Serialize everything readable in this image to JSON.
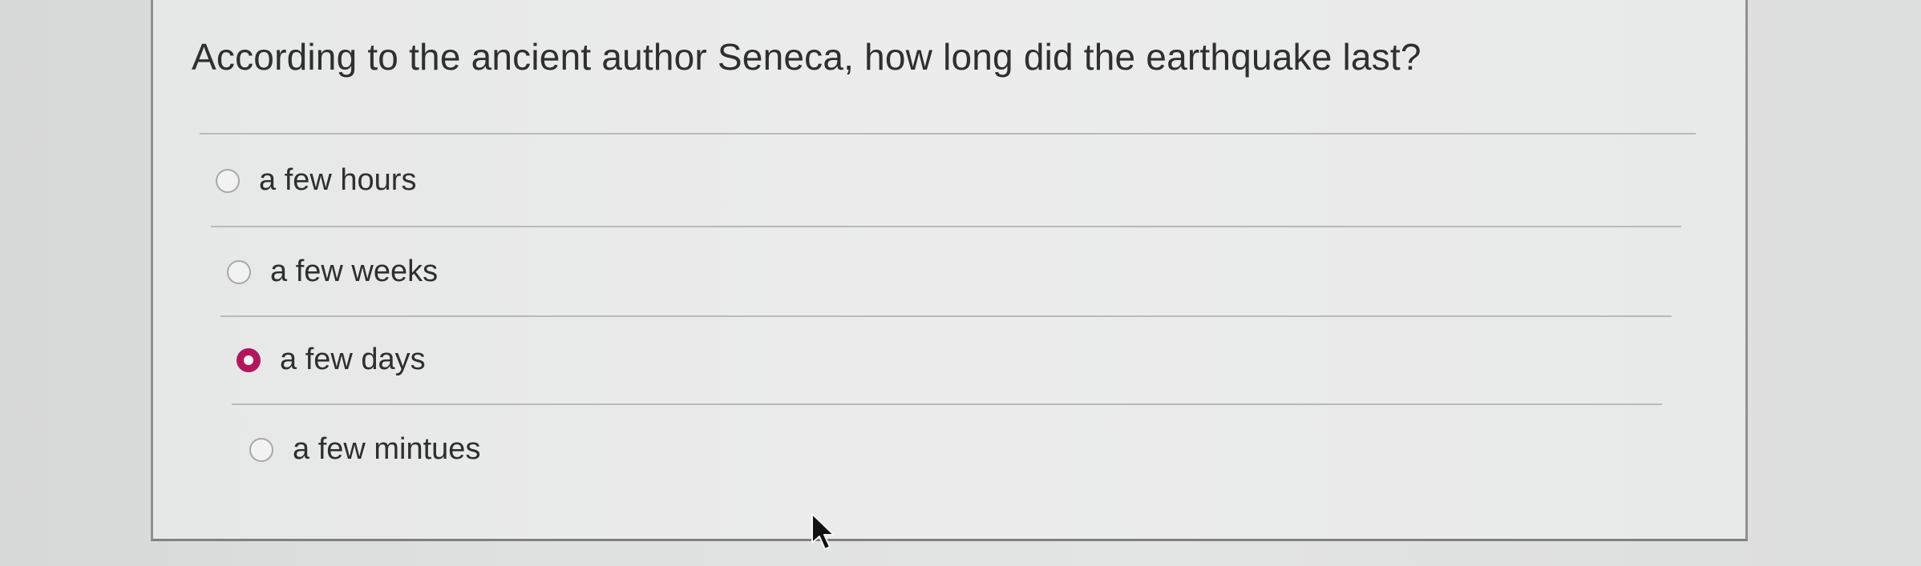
{
  "question": {
    "text": "According to the ancient author Seneca, how long did the earthquake last?"
  },
  "options": [
    {
      "label": "a few hours",
      "selected": false
    },
    {
      "label": "a few weeks",
      "selected": false
    },
    {
      "label": "a few days",
      "selected": true
    },
    {
      "label": "a few mintues",
      "selected": false
    }
  ],
  "colors": {
    "selected_radio": "#b3175a",
    "text": "#2f2f2f",
    "card_border": "#8f9090"
  },
  "icons": {
    "cursor": "mouse-pointer-icon"
  }
}
